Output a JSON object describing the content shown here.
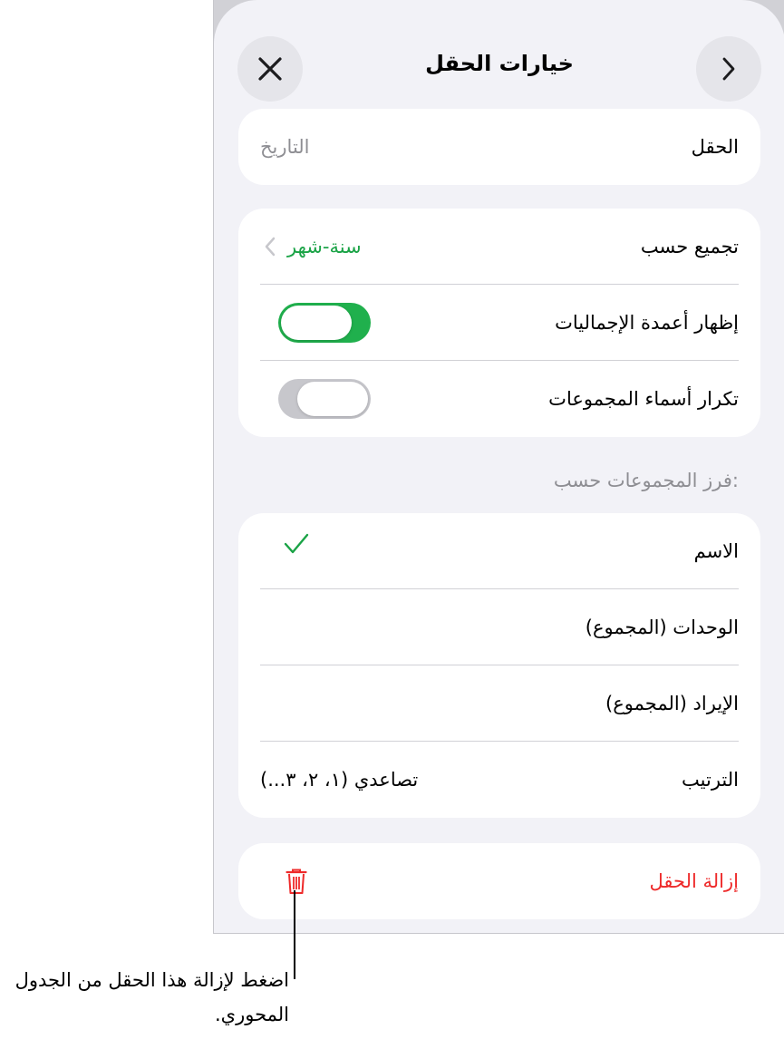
{
  "header": {
    "title": "خيارات الحقل",
    "close_icon": "close-icon",
    "back_icon": "chevron-right-icon"
  },
  "field_card": {
    "label": "الحقل",
    "value": "التاريخ"
  },
  "grouping_card": {
    "group_by": {
      "label": "تجميع حسب",
      "value": "سنة-شهر"
    },
    "show_totals": {
      "label": "إظهار أعمدة الإجماليات",
      "on": true
    },
    "repeat_names": {
      "label": "تكرار أسماء المجموعات",
      "on": false
    }
  },
  "sort_section": {
    "header": "فرز المجموعات حسب:",
    "options": [
      {
        "label": "الاسم",
        "selected": true
      },
      {
        "label": "الوحدات (المجموع)",
        "selected": false
      },
      {
        "label": "الإيراد (المجموع)",
        "selected": false
      }
    ],
    "order": {
      "label": "الترتيب",
      "value": "تصاعدي (١، ٢، ٣...)"
    }
  },
  "remove_card": {
    "label": "إزالة الحقل",
    "icon": "trash-icon"
  },
  "callout": {
    "text": "اضغط لإزالة هذا الحقل من الجدول المحوري."
  },
  "colors": {
    "accent_green": "#1aa346",
    "toggle_on": "#20b04d",
    "destructive_red": "#ee2a2a",
    "background": "#f2f2f7"
  }
}
